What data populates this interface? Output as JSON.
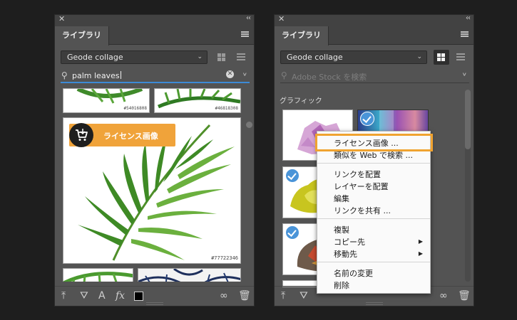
{
  "left_panel": {
    "tab_label": "ライブラリ",
    "library_name": "Geode collage",
    "search_value": "palm leaves",
    "license_label": "ライセンス画像",
    "stock_id_1": "#54016808",
    "stock_id_2": "#46818308",
    "stock_id_main": "#77722346"
  },
  "right_panel": {
    "tab_label": "ライブラリ",
    "library_name": "Geode collage",
    "search_placeholder": "Adobe Stock を検索",
    "section_label": "グラフィック"
  },
  "footer_glyphs": {
    "text_style": "A",
    "fx": "fx"
  },
  "context_menu": {
    "license": "ライセンス画像 ...",
    "find_similar": "類似を Web で検索 ...",
    "place_linked": "リンクを配置",
    "place_as_layer": "レイヤーを配置",
    "edit": "編集",
    "share_link": "リンクを共有 ...",
    "duplicate": "複製",
    "copy_to": "コピー先",
    "move_to": "移動先",
    "rename": "名前の変更",
    "delete": "削除"
  },
  "colors": {
    "panel": "#535353",
    "highlight_orange": "#f0a33a",
    "check_blue": "#4a94d8"
  }
}
